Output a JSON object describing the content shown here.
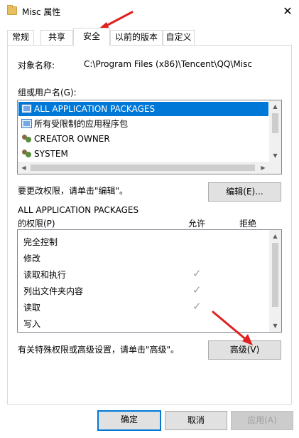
{
  "window": {
    "title": "Misc 属性",
    "close_glyph": "✕"
  },
  "tabs": [
    {
      "label": "常规",
      "selected": false
    },
    {
      "label": "共享",
      "selected": false
    },
    {
      "label": "安全",
      "selected": true
    },
    {
      "label": "以前的版本",
      "selected": false
    },
    {
      "label": "自定义",
      "selected": false
    }
  ],
  "security": {
    "object_name_label": "对象名称:",
    "object_name_value": "C:\\Program Files (x86)\\Tencent\\QQ\\Misc",
    "group_label": "组或用户名(G):",
    "users": [
      {
        "name": "ALL APPLICATION PACKAGES",
        "icon": "app-package-icon",
        "selected": true
      },
      {
        "name": "所有受限制的应用程序包",
        "icon": "app-package-icon",
        "selected": false
      },
      {
        "name": "CREATOR OWNER",
        "icon": "users-icon",
        "selected": false
      },
      {
        "name": "SYSTEM",
        "icon": "users-icon",
        "selected": false
      }
    ],
    "edit_hint": "要更改权限，请单击\"编辑\"。",
    "edit_button": "编辑(E)...",
    "perm_for_line1": "ALL APPLICATION PACKAGES",
    "perm_for_line2": "的权限(P)",
    "col_allow": "允许",
    "col_deny": "拒绝",
    "permissions": [
      {
        "name": "完全控制",
        "allow": false,
        "deny": false
      },
      {
        "name": "修改",
        "allow": false,
        "deny": false
      },
      {
        "name": "读取和执行",
        "allow": true,
        "deny": false
      },
      {
        "name": "列出文件夹内容",
        "allow": true,
        "deny": false
      },
      {
        "name": "读取",
        "allow": true,
        "deny": false
      },
      {
        "name": "写入",
        "allow": false,
        "deny": false
      }
    ],
    "advanced_hint": "有关特殊权限或高级设置，请单击\"高级\"。",
    "advanced_button": "高级(V)"
  },
  "footer": {
    "ok": "确定",
    "cancel": "取消",
    "apply": "应用(A)"
  },
  "glyphs": {
    "check": "✓",
    "up": "▲",
    "down": "▼",
    "left": "◀",
    "right": "▶"
  },
  "colors": {
    "selection": "#0078d7",
    "annotation_arrow": "#e02020"
  }
}
